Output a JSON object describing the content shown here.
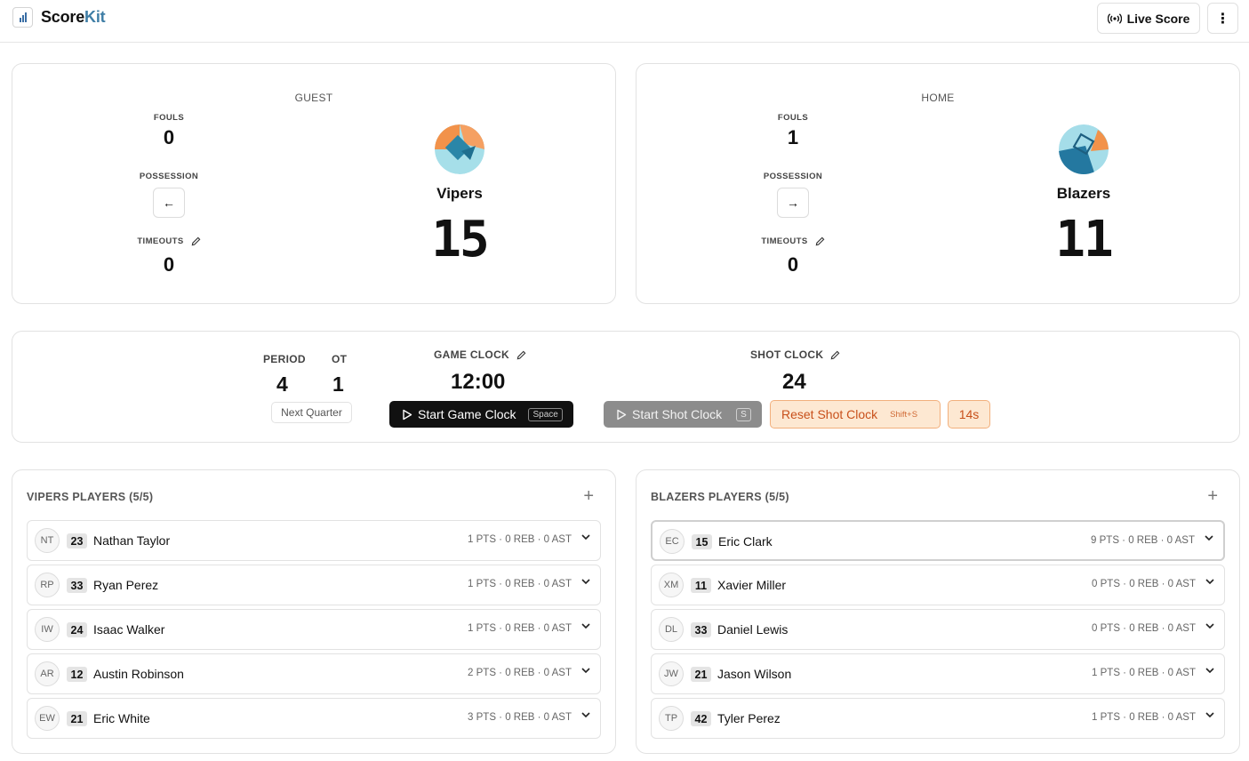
{
  "app": {
    "brand_part1": "Score",
    "brand_part2": "Kit",
    "live_label": "Live Score",
    "menu_glyph": "⋮",
    "icons": [
      "bar-chart-logo-icon",
      "broadcast-icon",
      "more-vertical-icon"
    ]
  },
  "teams": {
    "guest": {
      "side": "GUEST",
      "name": "Vipers",
      "score": "15",
      "fouls_label": "FOULS",
      "fouls": "0",
      "possession_label": "POSSESSION",
      "possession_arrow": "←",
      "timeouts_label": "TIMEOUTS",
      "timeouts": "0",
      "logo_colors": [
        "#f2924a",
        "#9fd8e6",
        "#2a86a8"
      ]
    },
    "home": {
      "side": "HOME",
      "name": "Blazers",
      "score": "11",
      "fouls_label": "FOULS",
      "fouls": "1",
      "possession_label": "POSSESSION",
      "possession_arrow": "→",
      "timeouts_label": "TIMEOUTS",
      "timeouts": "0",
      "logo_colors": [
        "#2478a0",
        "#a5dde9",
        "#f2924a"
      ]
    }
  },
  "clock": {
    "period_label": "PERIOD",
    "period": "4",
    "ot_label": "OT",
    "ot": "1",
    "next_quarter": "Next Quarter",
    "game_clock_label": "GAME CLOCK",
    "game_clock": "12:00",
    "start_game_clock": "Start Game Clock",
    "start_game_key": "Space",
    "shot_clock_label": "SHOT CLOCK",
    "shot_clock": "24",
    "start_shot_clock": "Start Shot Clock",
    "start_shot_key": "S",
    "reset_shot_clock": "Reset Shot Clock",
    "reset_shot_key": "Shift+S",
    "preset_14": "14s"
  },
  "players": {
    "left": {
      "title": "VIPERS PLAYERS (5/5)",
      "rows": [
        {
          "initials": "NT",
          "number": "23",
          "name": "Nathan Taylor",
          "stats": "1 PTS · 0 REB · 0 AST"
        },
        {
          "initials": "RP",
          "number": "33",
          "name": "Ryan Perez",
          "stats": "1 PTS · 0 REB · 0 AST"
        },
        {
          "initials": "IW",
          "number": "24",
          "name": "Isaac Walker",
          "stats": "1 PTS · 0 REB · 0 AST"
        },
        {
          "initials": "AR",
          "number": "12",
          "name": "Austin Robinson",
          "stats": "2 PTS · 0 REB · 0 AST"
        },
        {
          "initials": "EW",
          "number": "21",
          "name": "Eric White",
          "stats": "3 PTS · 0 REB · 0 AST"
        }
      ]
    },
    "right": {
      "title": "BLAZERS PLAYERS (5/5)",
      "rows": [
        {
          "initials": "EC",
          "number": "15",
          "name": "Eric Clark",
          "stats": "9 PTS · 0 REB · 0 AST"
        },
        {
          "initials": "XM",
          "number": "11",
          "name": "Xavier Miller",
          "stats": "0 PTS · 0 REB · 0 AST"
        },
        {
          "initials": "DL",
          "number": "33",
          "name": "Daniel Lewis",
          "stats": "0 PTS · 0 REB · 0 AST"
        },
        {
          "initials": "JW",
          "number": "21",
          "name": "Jason Wilson",
          "stats": "1 PTS · 0 REB · 0 AST"
        },
        {
          "initials": "TP",
          "number": "42",
          "name": "Tyler Perez",
          "stats": "1 PTS · 0 REB · 0 AST"
        }
      ]
    }
  }
}
